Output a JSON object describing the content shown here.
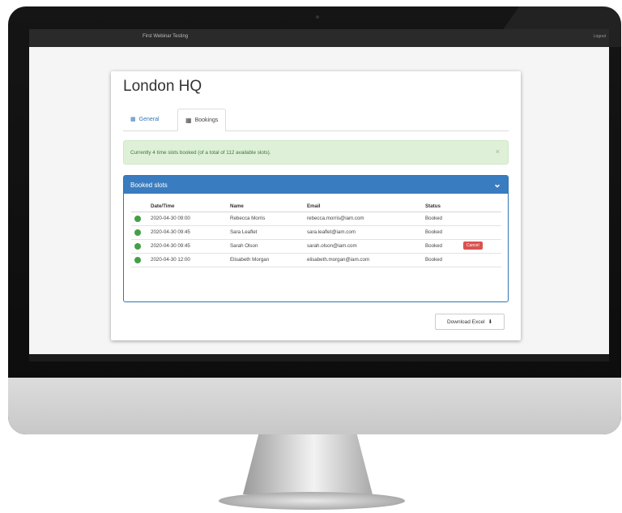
{
  "topbar": {
    "app_title": "First Webinar Testing",
    "logout_label": "Logout"
  },
  "page": {
    "title": "London HQ",
    "tabs": [
      {
        "label": "General",
        "icon": "grid-icon",
        "active": false
      },
      {
        "label": "Bookings",
        "icon": "calendar-icon",
        "active": true
      }
    ],
    "alert": {
      "text": "Currently 4 time slots booked (of a total of 112 available slots).",
      "close": "×"
    },
    "panel": {
      "title": "Booked slots",
      "toggle": "⌄",
      "columns": [
        "Date/Time",
        "Name",
        "Email",
        "Status"
      ],
      "rows": [
        {
          "datetime": "2020-04-30 09:00",
          "name": "Rebecca Morris",
          "email": "rebecca.morris@iam.com",
          "status": "Booked",
          "action": ""
        },
        {
          "datetime": "2020-04-30 09:45",
          "name": "Sara Leaflet",
          "email": "sara.leaflet@iam.com",
          "status": "Booked",
          "action": ""
        },
        {
          "datetime": "2020-04-30 09:45",
          "name": "Sarah Olson",
          "email": "sarah.olson@iam.com",
          "status": "Booked",
          "action": "Cancel"
        },
        {
          "datetime": "2020-04-30 12:00",
          "name": "Elisabeth Morgan",
          "email": "elisabeth.morgan@iam.com",
          "status": "Booked",
          "action": ""
        }
      ]
    },
    "download_label": "Download Excel"
  },
  "colors": {
    "accent": "#3a7cc0",
    "success_bg": "#dff0d8",
    "status_dot": "#43a047",
    "cancel": "#d9534f"
  }
}
